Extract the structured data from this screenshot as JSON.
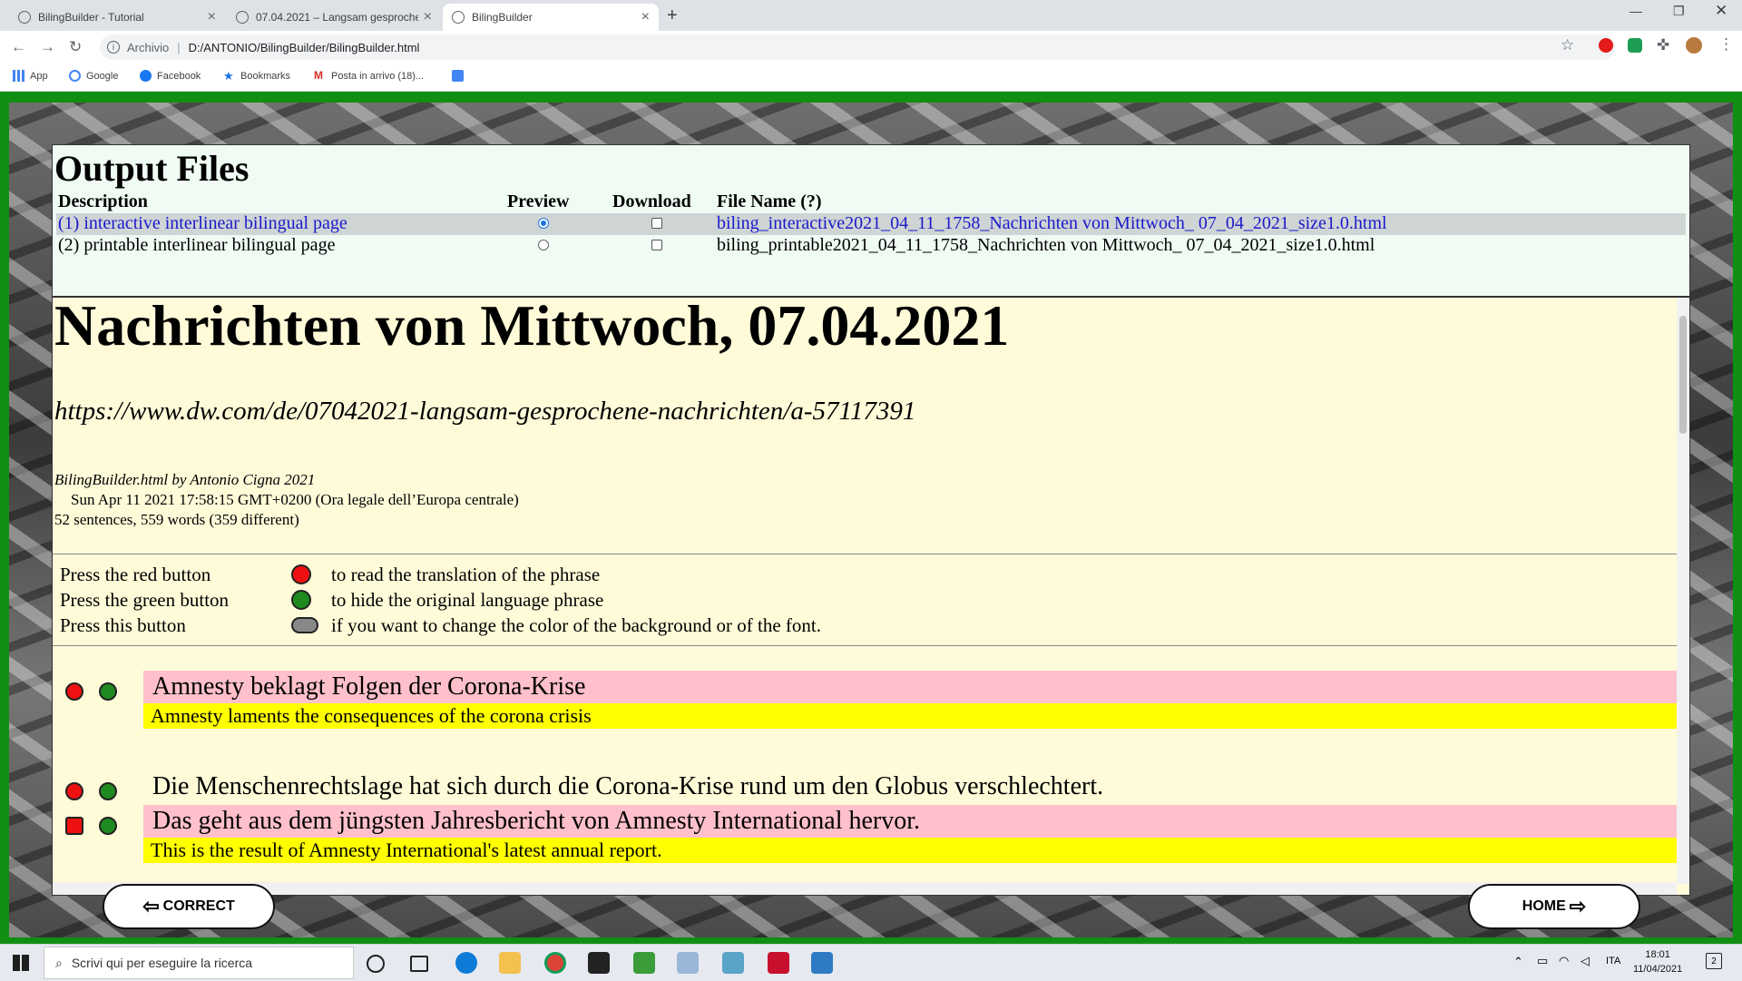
{
  "browser": {
    "tabs": [
      {
        "title": "BilingBuilder - Tutorial",
        "active": false
      },
      {
        "title": "07.04.2021 – Langsam gesproche",
        "active": false
      },
      {
        "title": "BilingBuilder",
        "active": true
      }
    ],
    "address": {
      "label": "Archivio",
      "url": "D:/ANTONIO/BilingBuilder/BilingBuilder.html"
    },
    "bookmarks": [
      {
        "label": "App",
        "icon": "apps-grid-icon"
      },
      {
        "label": "Google",
        "icon": "google-icon"
      },
      {
        "label": "Facebook",
        "icon": "facebook-icon"
      },
      {
        "label": "Bookmarks",
        "icon": "star-icon"
      },
      {
        "label": "Posta in arrivo (18)...",
        "icon": "gmail-icon"
      }
    ]
  },
  "output_files": {
    "title": "Output Files",
    "columns": {
      "description": "Description",
      "preview": "Preview",
      "download": "Download",
      "file_name": "File Name (?)"
    },
    "rows": [
      {
        "description": "(1) interactive interlinear bilingual page",
        "file_name": "biling_interactive2021_04_11_1758_Nachrichten von Mittwoch_ 07_04_2021_size1.0.html",
        "preview_selected": true,
        "download_checked": false
      },
      {
        "description": "(2) printable interlinear bilingual page",
        "file_name": "biling_printable2021_04_11_1758_Nachrichten von Mittwoch_ 07_04_2021_size1.0.html",
        "preview_selected": false,
        "download_checked": false
      }
    ]
  },
  "document": {
    "title": "Nachrichten von Mittwoch, 07.04.2021",
    "url": "https://www.dw.com/de/07042021-langsam-gesprochene-nachrichten/a-57117391",
    "author_line": "BilingBuilder.html by Antonio Cigna 2021",
    "date_line": "Sun Apr 11 2021 17:58:15 GMT+0200 (Ora legale dell’Europa centrale)",
    "stats_line": "52 sentences, 559 words (359 different)",
    "instructions": [
      {
        "label": "Press the red button",
        "text": "to read the translation of the phrase",
        "color": "#ee1111"
      },
      {
        "label": "Press the green button",
        "text": "to hide the original language phrase",
        "color": "#1f8a1f"
      },
      {
        "label": "Press this button",
        "text": "if you want to change the color of the background or of the font.",
        "color": "#888888"
      }
    ],
    "sentences": [
      {
        "original": "Amnesty beklagt Folgen der Corona-Krise",
        "translation": "Amnesty laments the consequences of the corona crisis"
      },
      {
        "original": "Die Menschenrechtslage hat sich durch die Corona-Krise rund um den Globus verschlechtert.",
        "translation": ""
      },
      {
        "original": "Das geht aus dem jüngsten Jahresbericht von Amnesty International hervor.",
        "translation": "This is the result of Amnesty International's latest annual report."
      }
    ]
  },
  "nav": {
    "correct": "CORRECT",
    "home": "HOME"
  },
  "taskbar": {
    "search_placeholder": "Scrivi qui per eseguire la ricerca",
    "lang": "ITA",
    "time": "18:01",
    "date": "11/04/2021",
    "notifications": "2"
  }
}
